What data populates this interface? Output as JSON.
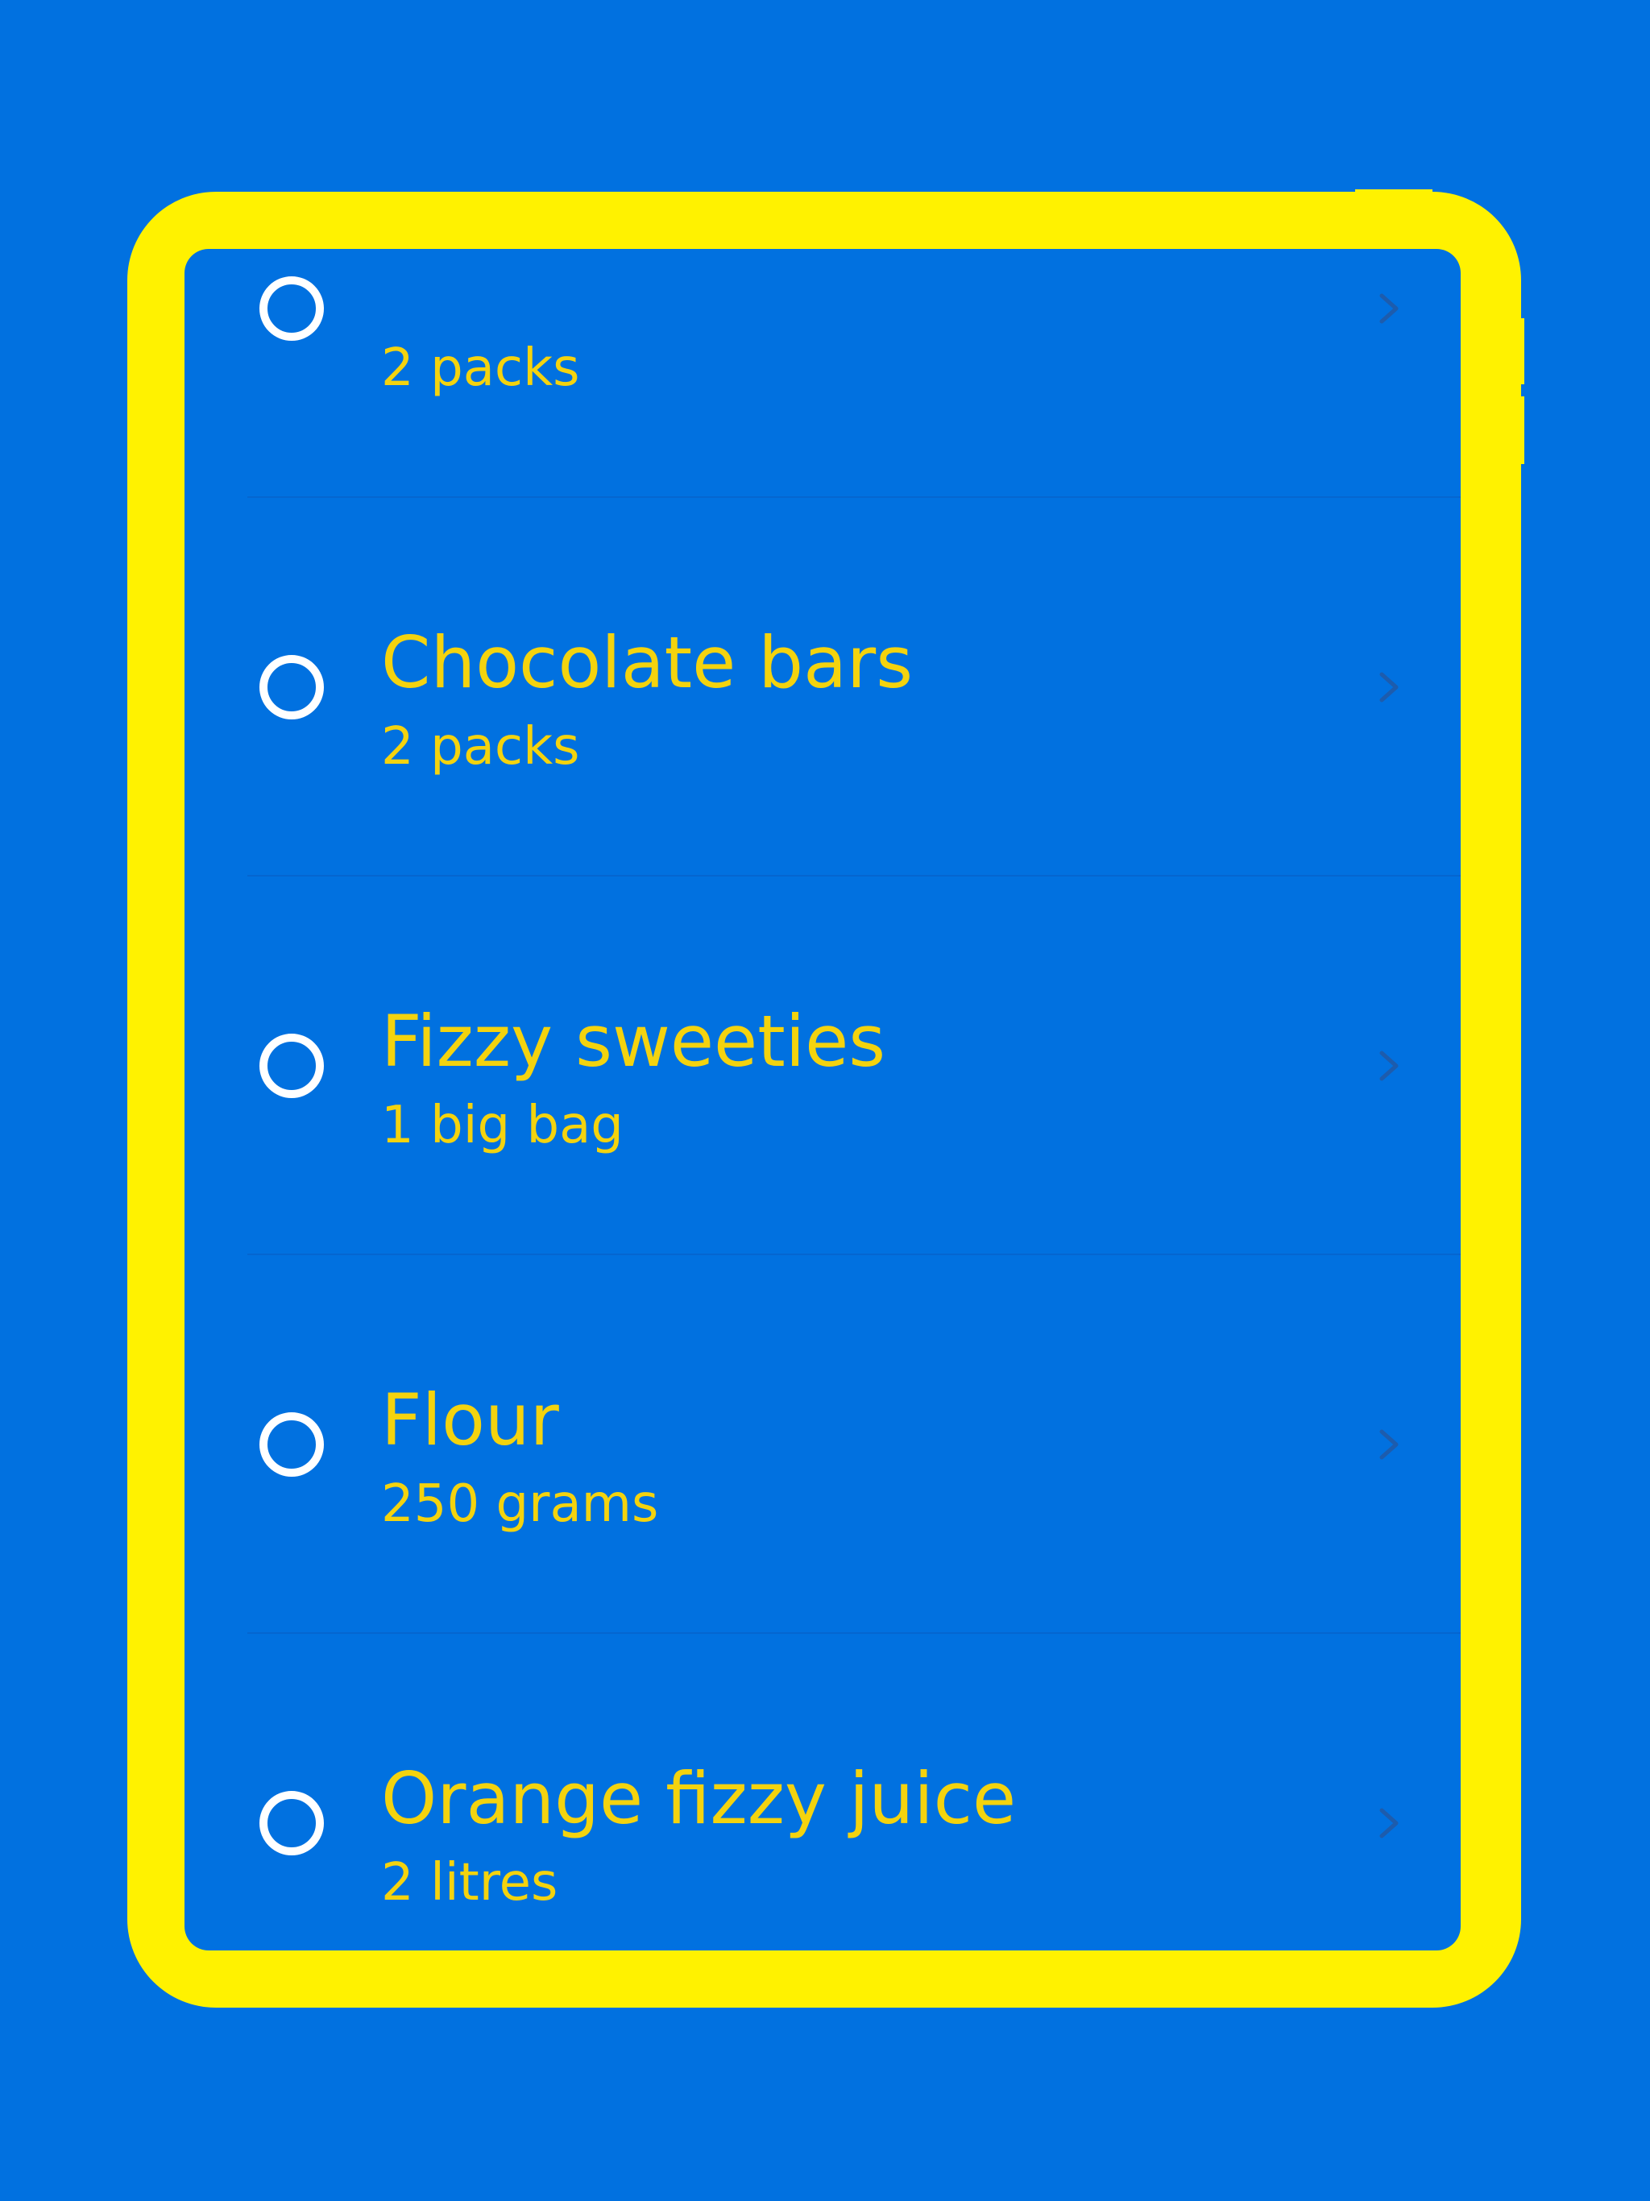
{
  "colors": {
    "background": "#0171e0",
    "frame": "#fff200",
    "text": "#f4d30e",
    "checkbox": "#ffffff",
    "chevron": "#1d5cad",
    "separator": "#0566d0"
  },
  "list": {
    "items": [
      {
        "title": "",
        "subtitle": "2 packs",
        "checked": false,
        "icon": "chevron-right-icon"
      },
      {
        "title": "Chocolate bars",
        "subtitle": "2 packs",
        "checked": false,
        "icon": "chevron-right-icon"
      },
      {
        "title": "Fizzy sweeties",
        "subtitle": "1 big bag",
        "checked": false,
        "icon": "chevron-right-icon"
      },
      {
        "title": "Flour",
        "subtitle": "250 grams",
        "checked": false,
        "icon": "chevron-right-icon"
      },
      {
        "title": "Orange fizzy juice",
        "subtitle": "2 litres",
        "checked": false,
        "icon": "chevron-right-icon"
      }
    ]
  }
}
